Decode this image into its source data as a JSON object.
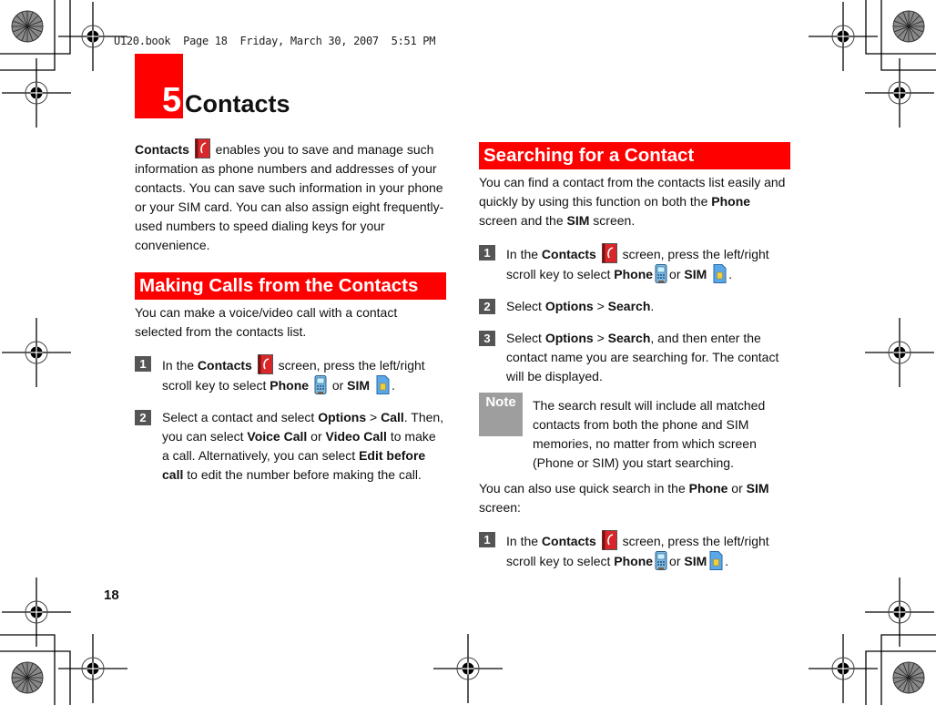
{
  "header": {
    "print_line": "U120.book  Page 18  Friday, March 30, 2007  5:51 PM"
  },
  "chapter": {
    "number": "5",
    "title": "Contacts"
  },
  "intro": {
    "lead_bold": "Contacts",
    "text": " enables you to save and manage such information as phone numbers and addresses of your contacts. You can save such information in your phone or your SIM card. You can also assign eight frequently-used numbers to speed dialing keys for your convenience."
  },
  "section_calls": {
    "title": "Making Calls from the Contacts",
    "intro": "You can make a voice/video call with a contact selected from the contacts list.",
    "steps": [
      {
        "num": "1",
        "t1": " In the ",
        "b1": "Contacts",
        "t2": " screen, press the left/right scroll key to select ",
        "b2": "Phone",
        "t3": " or ",
        "b3": "SIM",
        "t4": "."
      },
      {
        "num": "2",
        "t1": " Select a contact and select ",
        "b1": "Options",
        "t2": " > ",
        "b2": "Call",
        "t3": ". Then, you can select ",
        "b3": "Voice Call",
        "t4": " or ",
        "b4": "Video Call",
        "t5": " to make a call. Alternatively, you can select ",
        "b5": "Edit before call",
        "t6": " to edit the number before making the call."
      }
    ]
  },
  "section_search": {
    "title": "Searching for a Contact",
    "intro_t1": "You can find a contact from the contacts list easily and quickly by using this function on both the ",
    "intro_b1": "Phone",
    "intro_t2": " screen and the ",
    "intro_b2": "SIM",
    "intro_t3": " screen.",
    "steps": [
      {
        "num": "1",
        "t1": " In the ",
        "b1": "Contacts",
        "t2": " screen, press the left/right scroll key to select ",
        "b2": "Phone",
        "t3": "or ",
        "b3": "SIM",
        "t4": "."
      },
      {
        "num": "2",
        "t1": "Select ",
        "b1": "Options",
        "t2": " > ",
        "b2": "Search",
        "t3": "."
      },
      {
        "num": "3",
        "t1": "Select ",
        "b1": "Options",
        "t2": " > ",
        "b2": "Search",
        "t3": ", and then enter the contact name you are searching for. The contact will be displayed."
      }
    ],
    "note_label": "Note",
    "note_text": "The search result will include all matched contacts from both the phone and SIM memories, no matter from which screen (Phone or SIM) you start searching.",
    "quick_t1": "You can also use quick search in the ",
    "quick_b1": "Phone",
    "quick_t2": " or ",
    "quick_b2": "SIM",
    "quick_t3": " screen:",
    "quick_steps": [
      {
        "num": "1",
        "t1": "In the ",
        "b1": "Contacts",
        "t2": " screen, press the left/right scroll key to select ",
        "b2": "Phone",
        "t3": "or ",
        "b3": "SIM",
        "t4": "."
      }
    ]
  },
  "footer": {
    "page_number": "18"
  },
  "colors": {
    "accent": "#ff0000",
    "step_badge": "#555555",
    "note_badge": "#9e9e9e"
  }
}
